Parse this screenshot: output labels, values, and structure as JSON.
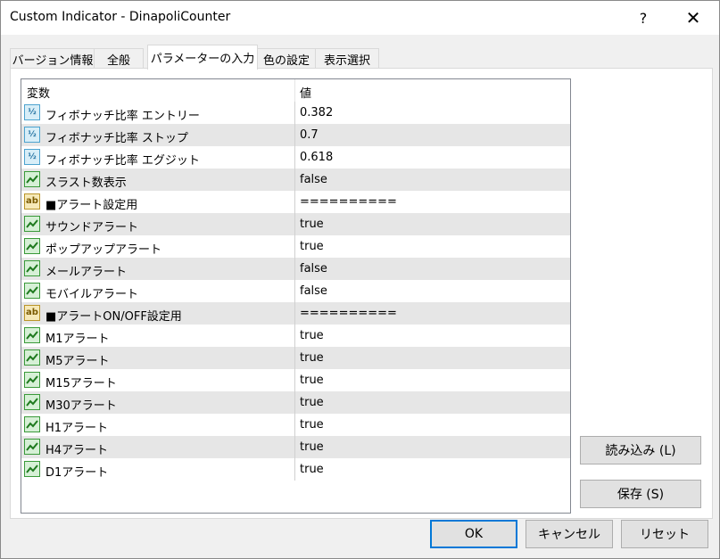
{
  "window": {
    "title": "Custom Indicator - DinapoliCounter",
    "help": "?",
    "close": "✕"
  },
  "tabs": [
    {
      "label": "バージョン情報"
    },
    {
      "label": "全般"
    },
    {
      "label": "パラメーターの入力"
    },
    {
      "label": "色の設定"
    },
    {
      "label": "表示選択"
    }
  ],
  "grid": {
    "headers": {
      "variable": "変数",
      "value": "値"
    },
    "rows": [
      {
        "icon": "double-icon",
        "name": "フィボナッチ比率 エントリー",
        "value": "0.382"
      },
      {
        "icon": "double-icon",
        "name": "フィボナッチ比率 ストップ",
        "value": "0.7"
      },
      {
        "icon": "double-icon",
        "name": "フィボナッチ比率 エグジット",
        "value": "0.618"
      },
      {
        "icon": "bool-icon",
        "name": "スラスト数表示",
        "value": "false"
      },
      {
        "icon": "string-icon",
        "name": "■アラート設定用",
        "value": "=========="
      },
      {
        "icon": "bool-icon",
        "name": "サウンドアラート",
        "value": "true"
      },
      {
        "icon": "bool-icon",
        "name": "ポップアップアラート",
        "value": "true"
      },
      {
        "icon": "bool-icon",
        "name": "メールアラート",
        "value": "false"
      },
      {
        "icon": "bool-icon",
        "name": "モバイルアラート",
        "value": "false"
      },
      {
        "icon": "string-icon",
        "name": "■アラートON/OFF設定用",
        "value": "=========="
      },
      {
        "icon": "bool-icon",
        "name": "M1アラート",
        "value": "true"
      },
      {
        "icon": "bool-icon",
        "name": "M5アラート",
        "value": "true"
      },
      {
        "icon": "bool-icon",
        "name": "M15アラート",
        "value": "true"
      },
      {
        "icon": "bool-icon",
        "name": "M30アラート",
        "value": "true"
      },
      {
        "icon": "bool-icon",
        "name": "H1アラート",
        "value": "true"
      },
      {
        "icon": "bool-icon",
        "name": "H4アラート",
        "value": "true"
      },
      {
        "icon": "bool-icon",
        "name": "D1アラート",
        "value": "true"
      }
    ]
  },
  "icon_text": {
    "double": "½",
    "string": "ab"
  },
  "side_buttons": {
    "load": "読み込み (L)",
    "save": "保存 (S)"
  },
  "footer": {
    "ok": "OK",
    "cancel": "キャンセル",
    "reset": "リセット"
  },
  "colors": {
    "accent": "#0078d7",
    "row_alt": "#e6e6e6"
  }
}
